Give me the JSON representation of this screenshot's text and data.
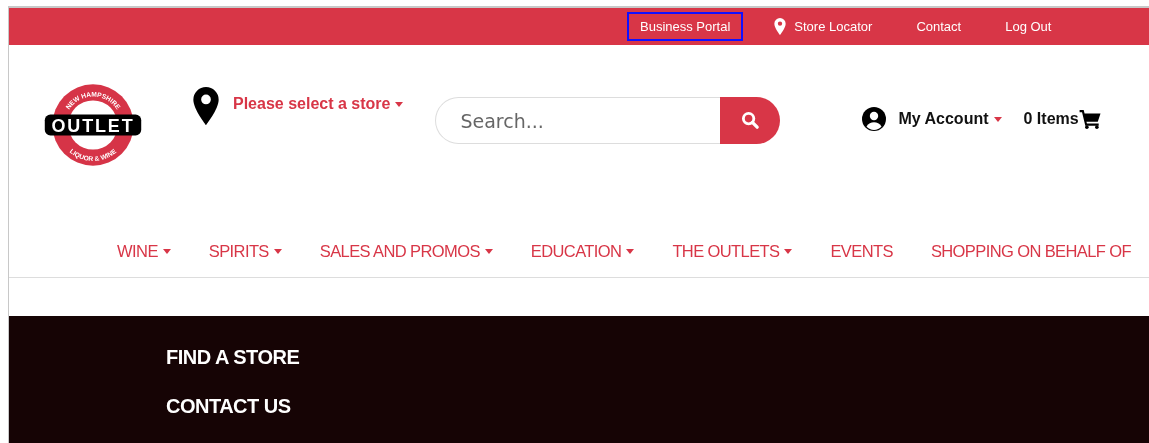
{
  "top_bar": {
    "links": [
      {
        "label": "Business Portal",
        "highlighted": true,
        "kind": "text"
      },
      {
        "label": "Store Locator",
        "highlighted": false,
        "kind": "pin"
      },
      {
        "label": "Contact",
        "highlighted": false,
        "kind": "text"
      },
      {
        "label": "Log Out",
        "highlighted": false,
        "kind": "text"
      }
    ]
  },
  "logo": {
    "top_text": "NEW HAMPSHIRE",
    "main_text": "OUTLET",
    "bottom_text": "LIQUOR & WINE"
  },
  "store_selector": {
    "label": "Please select a store"
  },
  "search": {
    "placeholder": "Search..."
  },
  "account": {
    "label": "My Account"
  },
  "cart": {
    "label": "0 Items"
  },
  "nav": [
    {
      "label": "WINE",
      "has_dropdown": true
    },
    {
      "label": "SPIRITS",
      "has_dropdown": true
    },
    {
      "label": "SALES AND PROMOS",
      "has_dropdown": true
    },
    {
      "label": "EDUCATION",
      "has_dropdown": true
    },
    {
      "label": "THE OUTLETS",
      "has_dropdown": true
    },
    {
      "label": "EVENTS",
      "has_dropdown": false
    },
    {
      "label": "SHOPPING ON BEHALF OF",
      "has_dropdown": false
    }
  ],
  "footer": {
    "links": [
      "FIND A STORE",
      "CONTACT US"
    ]
  }
}
